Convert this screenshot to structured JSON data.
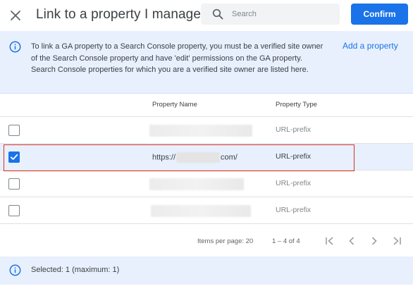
{
  "header": {
    "title": "Link to a property I manage",
    "search_placeholder": "Search",
    "confirm_label": "Confirm"
  },
  "info_banner": {
    "text": "To link a GA property to a Search Console property, you must be a verified site owner of the Search Console property and have 'edit' permissions on the GA property. Search Console properties for which you are a verified site owner are listed here.",
    "add_property_label": "Add a property"
  },
  "table": {
    "columns": [
      "Property Name",
      "Property Type"
    ],
    "rows": [
      {
        "name": "",
        "type": "URL-prefix",
        "checked": false
      },
      {
        "name_prefix": "https://",
        "name_suffix": "com/",
        "type": "URL-prefix",
        "checked": true
      },
      {
        "name": "",
        "type": "URL-prefix",
        "checked": false
      },
      {
        "name": "",
        "type": "URL-prefix",
        "checked": false
      }
    ]
  },
  "pagination": {
    "items_per_page_label": "Items per page: 20",
    "range_label": "1 – 4 of 4"
  },
  "footer": {
    "selected_text": "Selected: 1 (maximum: 1)"
  },
  "colors": {
    "accent": "#1a73e8",
    "banner_bg": "#e8f0fe",
    "highlight": "#d93025"
  },
  "icons": [
    "close-icon",
    "search-icon",
    "info-icon",
    "checkmark-icon",
    "first-page-icon",
    "prev-page-icon",
    "next-page-icon",
    "last-page-icon"
  ]
}
